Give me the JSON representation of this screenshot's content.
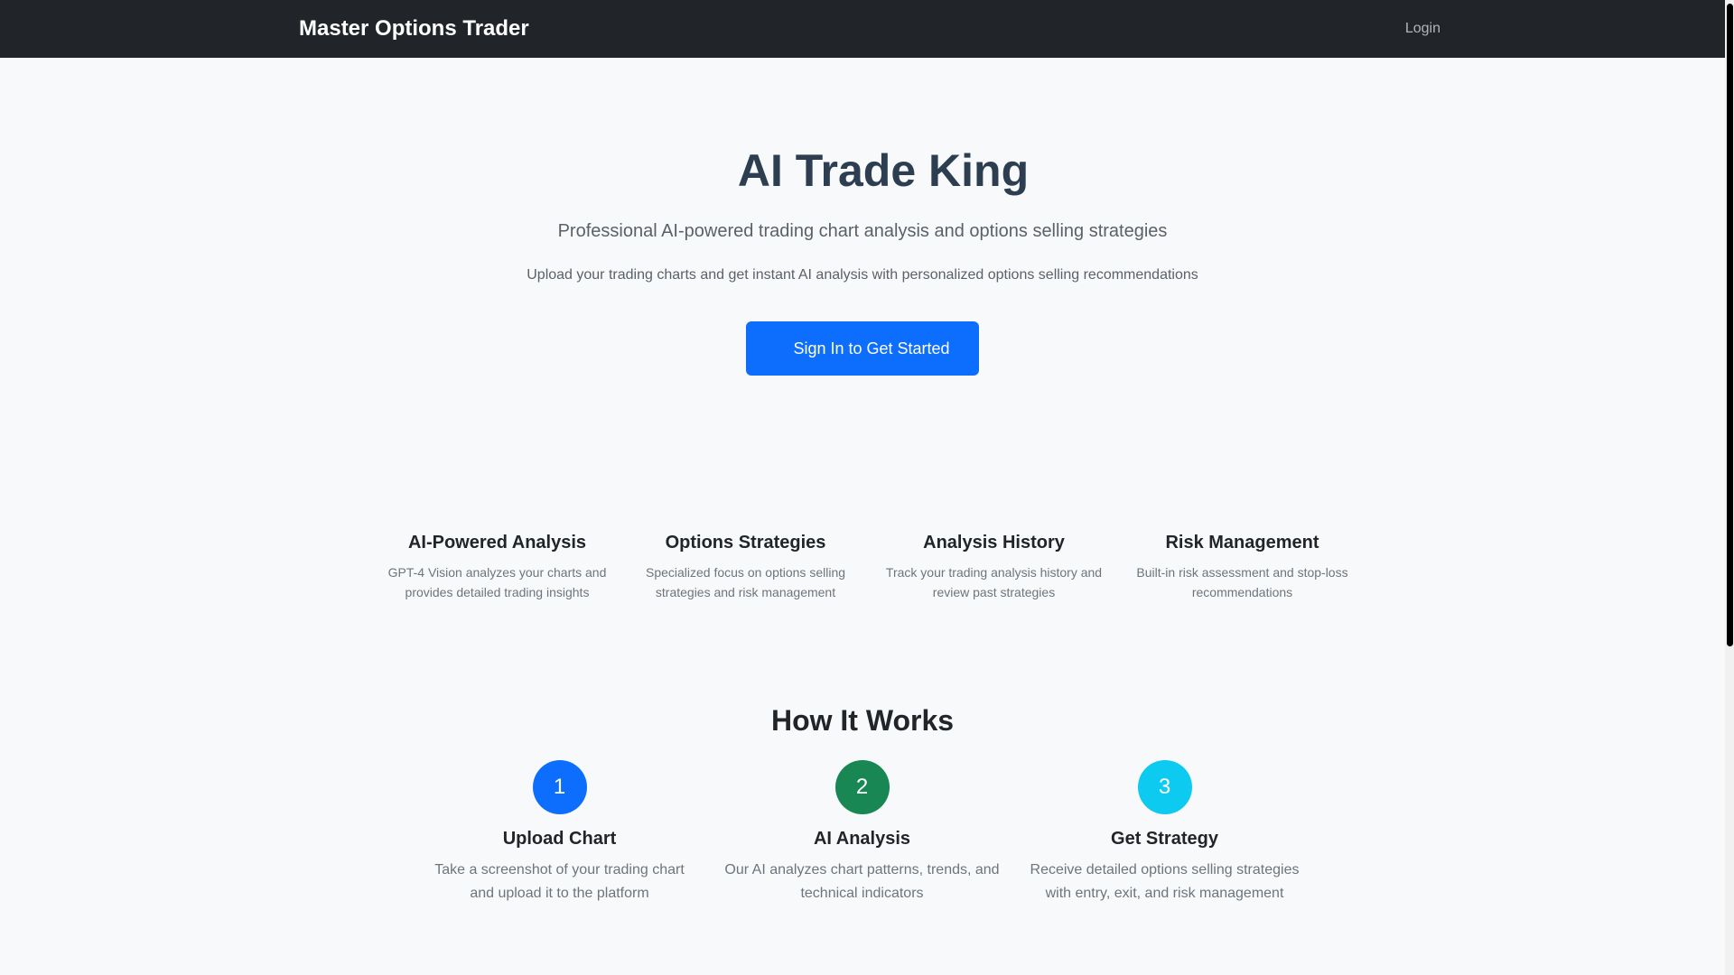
{
  "navbar": {
    "brand": "Master Options Trader",
    "login_label": "Login"
  },
  "hero": {
    "title": "AI Trade King",
    "subtitle": "Professional AI-powered trading chart analysis and options selling strategies",
    "lead": "Upload your trading charts and get instant AI analysis with personalized options selling recommendations",
    "cta_label": "Sign In to Get Started"
  },
  "features": [
    {
      "title": "AI-Powered Analysis",
      "text": "GPT-4 Vision analyzes your charts and provides detailed trading insights"
    },
    {
      "title": "Options Strategies",
      "text": "Specialized focus on options selling strategies and risk management"
    },
    {
      "title": "Analysis History",
      "text": "Track your trading analysis history and review past strategies"
    },
    {
      "title": "Risk Management",
      "text": "Built-in risk assessment and stop-loss recommendations"
    }
  ],
  "how_it_works": {
    "title": "How It Works",
    "steps": [
      {
        "number": "1",
        "title": "Upload Chart",
        "text": "Take a screenshot of your trading chart and upload it to the platform",
        "color": "#0d6efd"
      },
      {
        "number": "2",
        "title": "AI Analysis",
        "text": "Our AI analyzes chart patterns, trends, and technical indicators",
        "color": "#198754"
      },
      {
        "number": "3",
        "title": "Get Strategy",
        "text": "Receive detailed options selling strategies with entry, exit, and risk management",
        "color": "#0dcaf0"
      }
    ]
  },
  "colors": {
    "navbar_bg": "#212529",
    "primary": "#0d6efd",
    "success": "#198754",
    "info": "#0dcaf0",
    "hero_title": "#2c3e50",
    "page_bg": "#f8f9fa"
  }
}
